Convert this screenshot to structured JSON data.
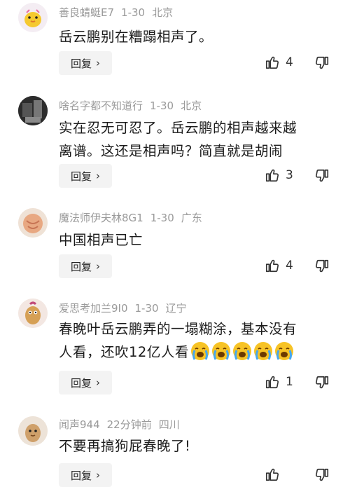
{
  "comments": [
    {
      "username": "善良蜻蜓E7",
      "date": "1-30",
      "location": "北京",
      "text": "岳云鹏别在糟蹋相声了。",
      "reply_label": "回复",
      "likes": "4",
      "avatar_icon": "chick-face-icon"
    },
    {
      "username": "啥名字都不知道行",
      "date": "1-30",
      "location": "北京",
      "text_line1": "实在忍无可忍了。岳云鹏的相声越来越",
      "text_line2": "离谱。这还是相声吗？简直就是胡闹",
      "reply_label": "回复",
      "likes": "3",
      "avatar_icon": "dark-photo-icon"
    },
    {
      "username": "魔法师伊夫林8G1",
      "date": "1-30",
      "location": "广东",
      "text": "中国相声已亡",
      "reply_label": "回复",
      "likes": "4",
      "avatar_icon": "peach-ball-icon"
    },
    {
      "username": "爱思考加兰9I0",
      "date": "1-30",
      "location": "辽宁",
      "text_line1": "春晚叶岳云鹏弄的一塌糊涂，基本没有",
      "text_line2": "人看，还吹12亿人看",
      "reply_label": "回复",
      "likes": "1",
      "avatar_icon": "bean-creature-icon",
      "emoji_name": "crying-face-emoji"
    },
    {
      "username": "闻声944",
      "date": "22分钟前",
      "location": "四川",
      "text": "不要再搞狗屁春晚了!",
      "reply_label": "回复",
      "likes": "",
      "avatar_icon": "peanut-creature-icon"
    }
  ],
  "colors": {
    "meta_text": "#9a9a9a",
    "reply_bg": "#f3f3f3",
    "emoji_yellow": "#f7c325"
  }
}
